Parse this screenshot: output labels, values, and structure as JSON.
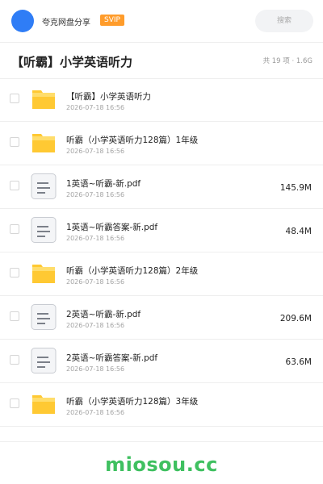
{
  "header": {
    "site_name": "夸克网盘分享",
    "badge": "SVIP",
    "search_placeholder": "搜索",
    "avatar_color": "#2f7df6",
    "badge_color": "#ff9c2b"
  },
  "folder": {
    "title": "【听霸】小学英语听力",
    "meta": "共 19 项 · 1.6G"
  },
  "files": [
    {
      "icon": "folder-icon",
      "name": "【听霸】小学英语听力",
      "date": "2026-07-18 16:56",
      "size": ""
    },
    {
      "icon": "folder-icon",
      "name": "听霸（小学英语听力128篇）1年级",
      "date": "2026-07-18 16:56",
      "size": ""
    },
    {
      "icon": "document-icon",
      "name": "1英语~听霸-新.pdf",
      "date": "2026-07-18 16:56",
      "size": "145.9M"
    },
    {
      "icon": "document-icon",
      "name": "1英语~听霸答案-新.pdf",
      "date": "2026-07-18 16:56",
      "size": "48.4M"
    },
    {
      "icon": "folder-icon",
      "name": "听霸（小学英语听力128篇）2年级",
      "date": "2026-07-18 16:56",
      "size": ""
    },
    {
      "icon": "document-icon",
      "name": "2英语~听霸-新.pdf",
      "date": "2026-07-18 16:56",
      "size": "209.6M"
    },
    {
      "icon": "document-icon",
      "name": "2英语~听霸答案-新.pdf",
      "date": "2026-07-18 16:56",
      "size": "63.6M"
    },
    {
      "icon": "folder-icon",
      "name": "听霸（小学英语听力128篇）3年级",
      "date": "2026-07-18 16:56",
      "size": ""
    }
  ],
  "watermark": "miosou.cc",
  "colors": {
    "folder": "#ffc933",
    "folder_tab": "#ffdd6b",
    "watermark": "#3fc060"
  }
}
